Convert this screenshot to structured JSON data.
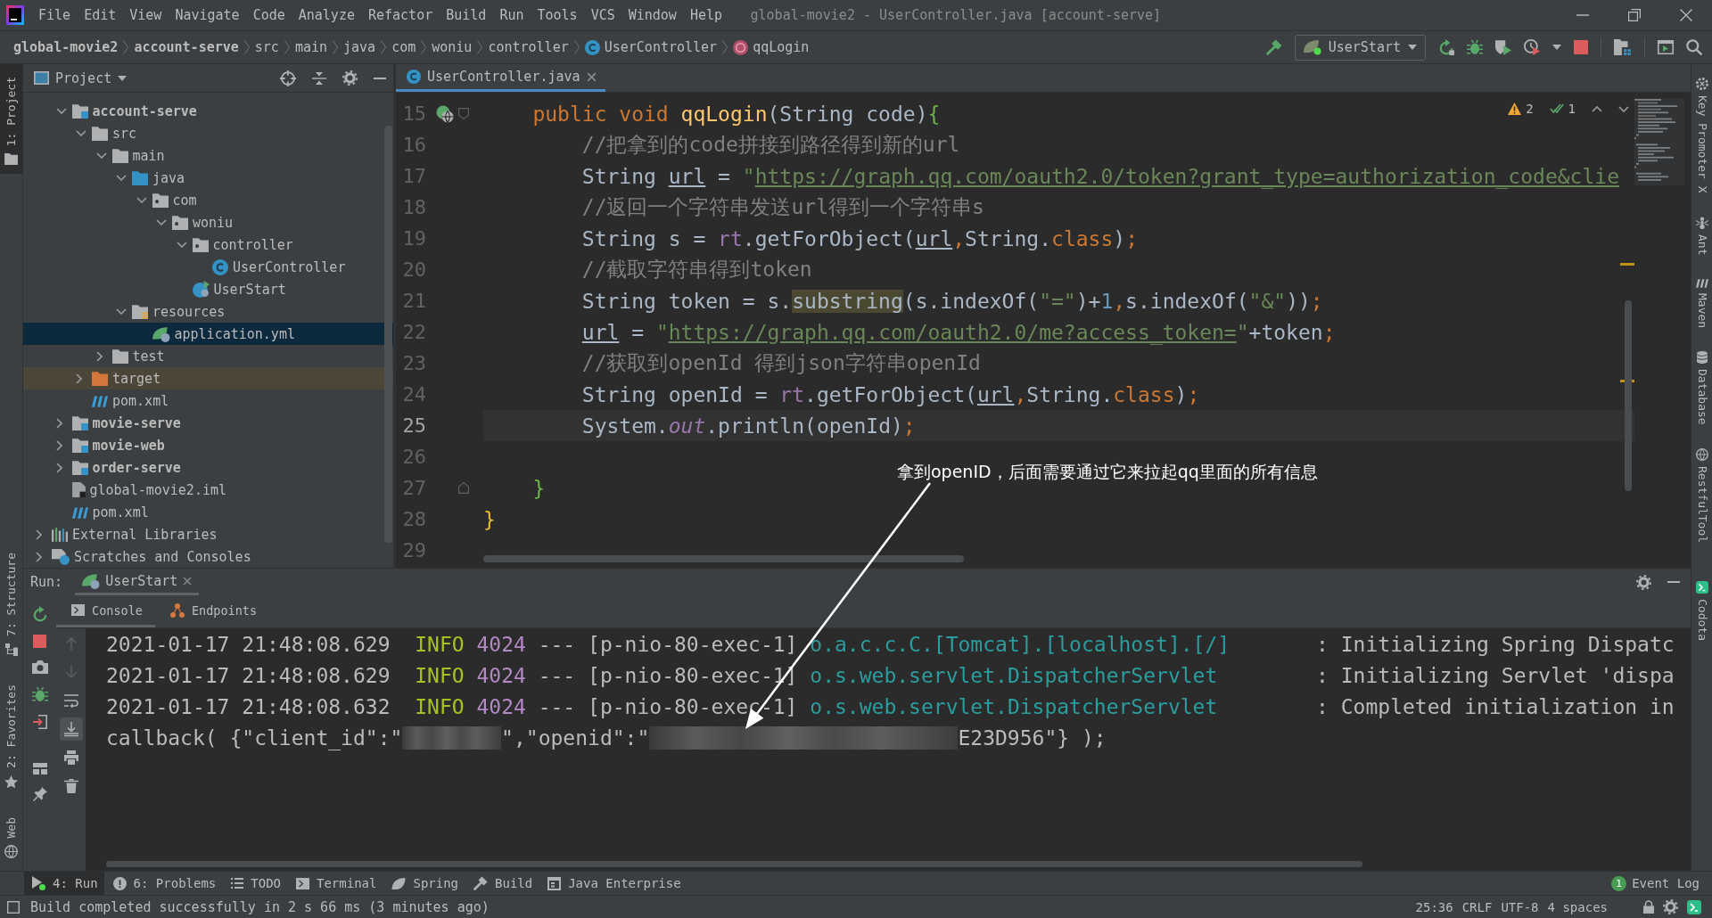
{
  "window": {
    "title": "global-movie2 - UserController.java [account-serve]"
  },
  "menu": [
    "File",
    "Edit",
    "View",
    "Navigate",
    "Code",
    "Analyze",
    "Refactor",
    "Build",
    "Run",
    "Tools",
    "VCS",
    "Window",
    "Help"
  ],
  "breadcrumbs": [
    {
      "label": "global-movie2",
      "kind": "module"
    },
    {
      "label": "account-serve",
      "kind": "module"
    },
    {
      "label": "src",
      "kind": "folder"
    },
    {
      "label": "main",
      "kind": "folder"
    },
    {
      "label": "java",
      "kind": "folder"
    },
    {
      "label": "com",
      "kind": "folder"
    },
    {
      "label": "woniu",
      "kind": "folder"
    },
    {
      "label": "controller",
      "kind": "folder"
    },
    {
      "label": "UserController",
      "kind": "class"
    },
    {
      "label": "qqLogin",
      "kind": "method"
    }
  ],
  "run_config": {
    "label": "UserStart"
  },
  "left_strip": {
    "top": [
      {
        "label": "1: Project",
        "kind": "project",
        "selected": true
      }
    ],
    "bottom": [
      {
        "label": "7: Structure",
        "kind": "structure",
        "selected": false
      },
      {
        "label": "2: Favorites",
        "kind": "favorites",
        "selected": false
      },
      {
        "label": "Web",
        "kind": "web",
        "selected": false
      }
    ]
  },
  "right_strip": {
    "top": [
      {
        "label": "Key Promoter X",
        "kind": "keypromoter"
      },
      {
        "label": "Ant",
        "kind": "ant"
      },
      {
        "label": "Maven",
        "kind": "maven"
      },
      {
        "label": "Database",
        "kind": "database"
      },
      {
        "label": "RestfulTool",
        "kind": "rest"
      }
    ],
    "bottom": [
      {
        "label": "Codota",
        "kind": "codota"
      }
    ]
  },
  "project": {
    "title": "Project",
    "tree": {
      "root_children": [
        {
          "label": "account-serve",
          "kind": "module",
          "expanded": true,
          "selected": false,
          "children": [
            {
              "label": "src",
              "kind": "folder",
              "expanded": true,
              "selected": false,
              "children": [
                {
                  "label": "main",
                  "kind": "folder",
                  "expanded": true,
                  "selected": false,
                  "children": [
                    {
                      "label": "java",
                      "kind": "source_root",
                      "expanded": true,
                      "selected": false,
                      "children": [
                        {
                          "label": "com",
                          "kind": "package",
                          "expanded": true,
                          "selected": false,
                          "children": [
                            {
                              "label": "woniu",
                              "kind": "package",
                              "expanded": true,
                              "selected": false,
                              "children": [
                                {
                                  "label": "controller",
                                  "kind": "package",
                                  "expanded": true,
                                  "selected": false,
                                  "children": [
                                    {
                                      "label": "UserController",
                                      "kind": "class",
                                      "selected": false
                                    }
                                  ]
                                },
                                {
                                  "label": "UserStart",
                                  "kind": "spring_app",
                                  "selected": false
                                }
                              ]
                            }
                          ]
                        }
                      ]
                    },
                    {
                      "label": "resources",
                      "kind": "resource_root",
                      "expanded": true,
                      "selected": false,
                      "children": [
                        {
                          "label": "application.yml",
                          "kind": "spring_config",
                          "selected": true
                        }
                      ]
                    }
                  ]
                },
                {
                  "label": "test",
                  "kind": "folder",
                  "expanded": false,
                  "selected": false
                }
              ]
            },
            {
              "label": "target",
              "kind": "excluded",
              "expanded": false,
              "selected": false
            },
            {
              "label": "pom.xml",
              "kind": "maven",
              "selected": false
            }
          ]
        },
        {
          "label": "movie-serve",
          "kind": "module",
          "expanded": false,
          "selected": false
        },
        {
          "label": "movie-web",
          "kind": "module",
          "expanded": false,
          "selected": false
        },
        {
          "label": "order-serve",
          "kind": "module",
          "expanded": false,
          "selected": false
        },
        {
          "label": "global-movie2.iml",
          "kind": "iml",
          "selected": false
        },
        {
          "label": "pom.xml",
          "kind": "maven",
          "selected": false
        }
      ],
      "items": [
        {
          "label": "External Libraries",
          "kind": "libraries",
          "expanded": false,
          "selected": false
        },
        {
          "label": "Scratches and Consoles",
          "kind": "scratches",
          "expanded": false,
          "selected": false
        }
      ]
    }
  },
  "editor": {
    "tabs": [
      {
        "label": "UserController.java",
        "selected": true
      }
    ],
    "inspection": {
      "warnings": "2",
      "weak_warnings": "1"
    },
    "lines": [
      {
        "number": "15",
        "current": false,
        "gutter": [
          {
            "kind": "endpoint"
          },
          {
            "kind": "fold_start"
          }
        ],
        "tokens": [
          {
            "text": "    public void ",
            "kind": "keyword"
          },
          {
            "text": "qqLogin",
            "kind": "method"
          },
          {
            "text": "(String code)",
            "kind": "plain"
          },
          {
            "text": "{",
            "kind": "brace_green"
          }
        ]
      },
      {
        "number": "16",
        "current": false,
        "tokens": [
          {
            "text": "        //把拿到的code拼接到路径得到新的url",
            "kind": "comment"
          }
        ]
      },
      {
        "number": "17",
        "current": false,
        "tokens": [
          {
            "text": "        String ",
            "kind": "plain"
          },
          {
            "text": "url",
            "kind": "reassigned"
          },
          {
            "text": " = ",
            "kind": "plain"
          },
          {
            "text": "\"",
            "kind": "string"
          },
          {
            "text": "https://graph.qq.com/oauth2.0/token?grant_type=authorization_code&clie",
            "kind": "link"
          }
        ]
      },
      {
        "number": "18",
        "current": false,
        "tokens": [
          {
            "text": "        //返回一个字符串发送url得到一个字符串s",
            "kind": "comment"
          }
        ]
      },
      {
        "number": "19",
        "current": false,
        "tokens": [
          {
            "text": "        String s = ",
            "kind": "plain"
          },
          {
            "text": "rt",
            "kind": "field"
          },
          {
            "text": ".getForObject(",
            "kind": "plain"
          },
          {
            "text": "url",
            "kind": "reassigned"
          },
          {
            "text": ",",
            "kind": "keyword"
          },
          {
            "text": "String.",
            "kind": "plain"
          },
          {
            "text": "class",
            "kind": "keyword"
          },
          {
            "text": ")",
            "kind": "plain"
          },
          {
            "text": ";",
            "kind": "keyword"
          }
        ]
      },
      {
        "number": "20",
        "current": false,
        "tokens": [
          {
            "text": "        //截取字符串得到token",
            "kind": "comment"
          }
        ]
      },
      {
        "number": "21",
        "current": false,
        "tokens": [
          {
            "text": "        String token = s.",
            "kind": "plain"
          },
          {
            "text": "substring",
            "kind": "highlight"
          },
          {
            "text": "(s.indexOf(",
            "kind": "plain"
          },
          {
            "text": "\"=\"",
            "kind": "string"
          },
          {
            "text": ")+",
            "kind": "plain"
          },
          {
            "text": "1",
            "kind": "number"
          },
          {
            "text": ",",
            "kind": "keyword"
          },
          {
            "text": "s.indexOf(",
            "kind": "plain"
          },
          {
            "text": "\"&\"",
            "kind": "string"
          },
          {
            "text": "))",
            "kind": "plain"
          },
          {
            "text": ";",
            "kind": "keyword"
          }
        ]
      },
      {
        "number": "22",
        "current": false,
        "tokens": [
          {
            "text": "        url",
            "kind": "reassigned"
          },
          {
            "text": " = ",
            "kind": "plain"
          },
          {
            "text": "\"",
            "kind": "string"
          },
          {
            "text": "https://graph.qq.com/oauth2.0/me?access_token=",
            "kind": "link"
          },
          {
            "text": "\"",
            "kind": "string"
          },
          {
            "text": "+token",
            "kind": "plain"
          },
          {
            "text": ";",
            "kind": "keyword"
          }
        ]
      },
      {
        "number": "23",
        "current": false,
        "tokens": [
          {
            "text": "        //获取到openId 得到json字符串openId",
            "kind": "comment"
          }
        ]
      },
      {
        "number": "24",
        "current": false,
        "tokens": [
          {
            "text": "        String openId = ",
            "kind": "plain"
          },
          {
            "text": "rt",
            "kind": "field"
          },
          {
            "text": ".getForObject(",
            "kind": "plain"
          },
          {
            "text": "url",
            "kind": "reassigned"
          },
          {
            "text": ",",
            "kind": "keyword"
          },
          {
            "text": "String.",
            "kind": "plain"
          },
          {
            "text": "class",
            "kind": "keyword"
          },
          {
            "text": ")",
            "kind": "plain"
          },
          {
            "text": ";",
            "kind": "keyword"
          }
        ]
      },
      {
        "number": "25",
        "current": true,
        "tokens": [
          {
            "text": "        System.",
            "kind": "plain"
          },
          {
            "text": "out",
            "kind": "static_field"
          },
          {
            "text": ".println(openId)",
            "kind": "plain"
          },
          {
            "text": ";",
            "kind": "keyword"
          }
        ]
      },
      {
        "number": "26",
        "current": false
      },
      {
        "number": "27",
        "current": false,
        "gutter": [
          {
            "kind": "fold_end"
          }
        ],
        "tokens": [
          {
            "text": "    }",
            "kind": "brace_green"
          }
        ]
      },
      {
        "number": "28",
        "current": false,
        "tokens": [
          {
            "text": "}",
            "kind": "brace_gold"
          }
        ]
      },
      {
        "number": "29",
        "current": false
      }
    ]
  },
  "annotation": {
    "text": "拿到openID，后面需要通过它来拉起qq里面的所有信息"
  },
  "run": {
    "label": "Run:",
    "tabs": [
      {
        "label": "UserStart",
        "selected": true
      }
    ],
    "subtabs": [
      {
        "label": "Console",
        "kind": "console",
        "selected": true
      },
      {
        "label": "Endpoints",
        "kind": "endpoints",
        "selected": false
      }
    ],
    "toolbar": [
      {
        "kind": "up",
        "disabled": true,
        "on": false
      },
      {
        "kind": "down",
        "disabled": true,
        "on": false
      },
      {
        "kind": "wrap",
        "disabled": false,
        "on": false
      },
      {
        "kind": "scroll_end",
        "disabled": false,
        "on": true
      },
      {
        "kind": "print",
        "disabled": false,
        "on": false
      },
      {
        "kind": "clear",
        "disabled": false,
        "on": false
      }
    ],
    "console": [
      {
        "tokens": [
          {
            "text": "2021-01-17 21:48:08.629  ",
            "kind": "plain"
          },
          {
            "text": "INFO ",
            "kind": "level"
          },
          {
            "text": "4024",
            "kind": "pid"
          },
          {
            "text": " --- [p-nio-80-exec-1] ",
            "kind": "plain"
          },
          {
            "text": "o.a.c.c.C.[Tomcat].[localhost].[/]",
            "kind": "logger"
          },
          {
            "text": "       : Initializing Spring Dispatc",
            "kind": "plain"
          }
        ]
      },
      {
        "tokens": [
          {
            "text": "2021-01-17 21:48:08.629  ",
            "kind": "plain"
          },
          {
            "text": "INFO ",
            "kind": "level"
          },
          {
            "text": "4024",
            "kind": "pid"
          },
          {
            "text": " --- [p-nio-80-exec-1] ",
            "kind": "plain"
          },
          {
            "text": "o.s.web.servlet.DispatcherServlet",
            "kind": "logger"
          },
          {
            "text": "        : Initializing Servlet 'dispa",
            "kind": "plain"
          }
        ]
      },
      {
        "tokens": [
          {
            "text": "2021-01-17 21:48:08.632  ",
            "kind": "plain"
          },
          {
            "text": "INFO ",
            "kind": "level"
          },
          {
            "text": "4024",
            "kind": "pid"
          },
          {
            "text": " --- [p-nio-80-exec-1] ",
            "kind": "plain"
          },
          {
            "text": "o.s.web.servlet.DispatcherServlet",
            "kind": "logger"
          },
          {
            "text": "        : Completed initialization in",
            "kind": "plain"
          }
        ]
      },
      {
        "tokens": [
          {
            "text": "callback( {\"client_id\":\"",
            "kind": "plain"
          },
          {
            "kind": "redacted"
          },
          {
            "text": "\",\"openid\":\"",
            "kind": "plain"
          },
          {
            "kind": "redacted"
          },
          {
            "text": "E23D956\"} );",
            "kind": "plain"
          }
        ]
      }
    ]
  },
  "tool_windows": [
    {
      "label": "4: Run",
      "kind": "run",
      "selected": true
    },
    {
      "label": "6: Problems",
      "kind": "problems",
      "selected": false
    },
    {
      "label": "TODO",
      "kind": "todo",
      "selected": false
    },
    {
      "label": "Terminal",
      "kind": "terminal",
      "selected": false
    },
    {
      "label": "Spring",
      "kind": "spring",
      "selected": false
    },
    {
      "label": "Build",
      "kind": "build",
      "selected": false
    },
    {
      "label": "Java Enterprise",
      "kind": "javaee",
      "selected": false
    }
  ],
  "event_log": {
    "label": "Event Log",
    "count": "1"
  },
  "status_bar": {
    "message": "Build completed successfully in 2 s 66 ms (3 minutes ago)",
    "position": "25:36",
    "line_separator": "CRLF",
    "encoding": "UTF-8",
    "indent": "4 spaces"
  }
}
